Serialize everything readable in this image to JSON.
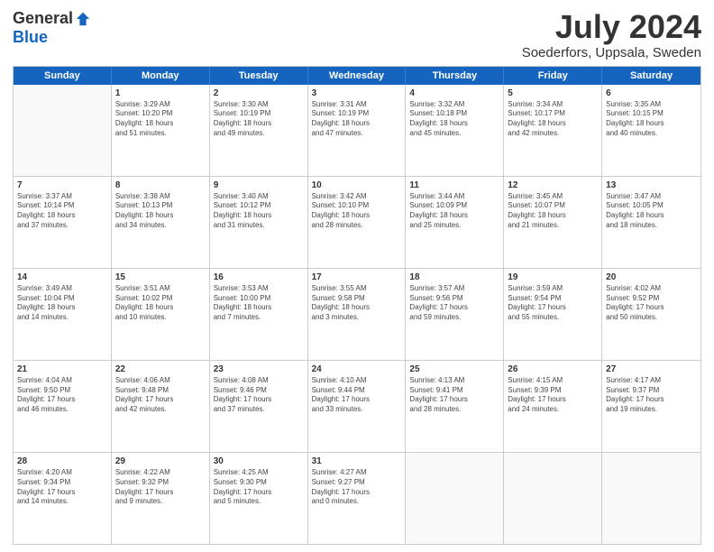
{
  "header": {
    "logo_general": "General",
    "logo_blue": "Blue",
    "title": "July 2024",
    "location": "Soederfors, Uppsala, Sweden"
  },
  "days_of_week": [
    "Sunday",
    "Monday",
    "Tuesday",
    "Wednesday",
    "Thursday",
    "Friday",
    "Saturday"
  ],
  "weeks": [
    [
      {
        "day": "",
        "content": ""
      },
      {
        "day": "1",
        "content": "Sunrise: 3:29 AM\nSunset: 10:20 PM\nDaylight: 18 hours\nand 51 minutes."
      },
      {
        "day": "2",
        "content": "Sunrise: 3:30 AM\nSunset: 10:19 PM\nDaylight: 18 hours\nand 49 minutes."
      },
      {
        "day": "3",
        "content": "Sunrise: 3:31 AM\nSunset: 10:19 PM\nDaylight: 18 hours\nand 47 minutes."
      },
      {
        "day": "4",
        "content": "Sunrise: 3:32 AM\nSunset: 10:18 PM\nDaylight: 18 hours\nand 45 minutes."
      },
      {
        "day": "5",
        "content": "Sunrise: 3:34 AM\nSunset: 10:17 PM\nDaylight: 18 hours\nand 42 minutes."
      },
      {
        "day": "6",
        "content": "Sunrise: 3:35 AM\nSunset: 10:15 PM\nDaylight: 18 hours\nand 40 minutes."
      }
    ],
    [
      {
        "day": "7",
        "content": "Sunrise: 3:37 AM\nSunset: 10:14 PM\nDaylight: 18 hours\nand 37 minutes."
      },
      {
        "day": "8",
        "content": "Sunrise: 3:38 AM\nSunset: 10:13 PM\nDaylight: 18 hours\nand 34 minutes."
      },
      {
        "day": "9",
        "content": "Sunrise: 3:40 AM\nSunset: 10:12 PM\nDaylight: 18 hours\nand 31 minutes."
      },
      {
        "day": "10",
        "content": "Sunrise: 3:42 AM\nSunset: 10:10 PM\nDaylight: 18 hours\nand 28 minutes."
      },
      {
        "day": "11",
        "content": "Sunrise: 3:44 AM\nSunset: 10:09 PM\nDaylight: 18 hours\nand 25 minutes."
      },
      {
        "day": "12",
        "content": "Sunrise: 3:45 AM\nSunset: 10:07 PM\nDaylight: 18 hours\nand 21 minutes."
      },
      {
        "day": "13",
        "content": "Sunrise: 3:47 AM\nSunset: 10:05 PM\nDaylight: 18 hours\nand 18 minutes."
      }
    ],
    [
      {
        "day": "14",
        "content": "Sunrise: 3:49 AM\nSunset: 10:04 PM\nDaylight: 18 hours\nand 14 minutes."
      },
      {
        "day": "15",
        "content": "Sunrise: 3:51 AM\nSunset: 10:02 PM\nDaylight: 18 hours\nand 10 minutes."
      },
      {
        "day": "16",
        "content": "Sunrise: 3:53 AM\nSunset: 10:00 PM\nDaylight: 18 hours\nand 7 minutes."
      },
      {
        "day": "17",
        "content": "Sunrise: 3:55 AM\nSunset: 9:58 PM\nDaylight: 18 hours\nand 3 minutes."
      },
      {
        "day": "18",
        "content": "Sunrise: 3:57 AM\nSunset: 9:56 PM\nDaylight: 17 hours\nand 59 minutes."
      },
      {
        "day": "19",
        "content": "Sunrise: 3:59 AM\nSunset: 9:54 PM\nDaylight: 17 hours\nand 55 minutes."
      },
      {
        "day": "20",
        "content": "Sunrise: 4:02 AM\nSunset: 9:52 PM\nDaylight: 17 hours\nand 50 minutes."
      }
    ],
    [
      {
        "day": "21",
        "content": "Sunrise: 4:04 AM\nSunset: 9:50 PM\nDaylight: 17 hours\nand 46 minutes."
      },
      {
        "day": "22",
        "content": "Sunrise: 4:06 AM\nSunset: 9:48 PM\nDaylight: 17 hours\nand 42 minutes."
      },
      {
        "day": "23",
        "content": "Sunrise: 4:08 AM\nSunset: 9:46 PM\nDaylight: 17 hours\nand 37 minutes."
      },
      {
        "day": "24",
        "content": "Sunrise: 4:10 AM\nSunset: 9:44 PM\nDaylight: 17 hours\nand 33 minutes."
      },
      {
        "day": "25",
        "content": "Sunrise: 4:13 AM\nSunset: 9:41 PM\nDaylight: 17 hours\nand 28 minutes."
      },
      {
        "day": "26",
        "content": "Sunrise: 4:15 AM\nSunset: 9:39 PM\nDaylight: 17 hours\nand 24 minutes."
      },
      {
        "day": "27",
        "content": "Sunrise: 4:17 AM\nSunset: 9:37 PM\nDaylight: 17 hours\nand 19 minutes."
      }
    ],
    [
      {
        "day": "28",
        "content": "Sunrise: 4:20 AM\nSunset: 9:34 PM\nDaylight: 17 hours\nand 14 minutes."
      },
      {
        "day": "29",
        "content": "Sunrise: 4:22 AM\nSunset: 9:32 PM\nDaylight: 17 hours\nand 9 minutes."
      },
      {
        "day": "30",
        "content": "Sunrise: 4:25 AM\nSunset: 9:30 PM\nDaylight: 17 hours\nand 5 minutes."
      },
      {
        "day": "31",
        "content": "Sunrise: 4:27 AM\nSunset: 9:27 PM\nDaylight: 17 hours\nand 0 minutes."
      },
      {
        "day": "",
        "content": ""
      },
      {
        "day": "",
        "content": ""
      },
      {
        "day": "",
        "content": ""
      }
    ]
  ]
}
